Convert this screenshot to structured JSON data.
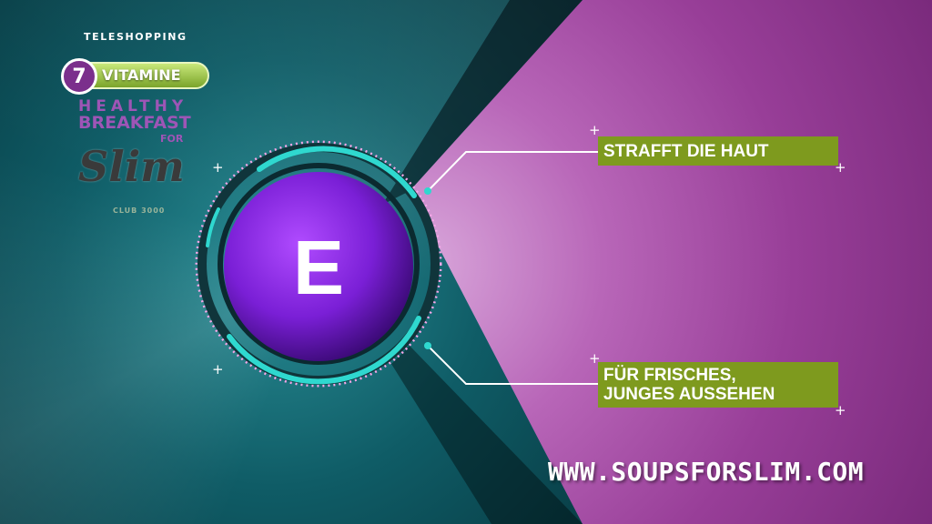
{
  "colors": {
    "teal": "#0f5c66",
    "magenta": "#983e98",
    "accent_green": "#7e9a1e",
    "sphere_purple": "#7a1fd6",
    "ring_cyan": "#2fd8cf"
  },
  "logo": {
    "teleshopping": "TELESHOPPING",
    "vitamin_count": "7",
    "vitamin_label": "VITAMINE",
    "line_healthy": "HEALTHY",
    "line_breakfast": "BREAKFAST",
    "line_for": "FOR",
    "line_slim": "Slim",
    "line_sub": "CLUB 3000"
  },
  "center": {
    "letter": "E"
  },
  "callouts": [
    {
      "lines": [
        "STRAFFT DIE HAUT"
      ]
    },
    {
      "lines": [
        "FÜR FRISCHES,",
        "JUNGES AUSSEHEN"
      ]
    }
  ],
  "website": "WWW.SOUPSFORSLIM.COM",
  "icons": [
    "plus-icon"
  ]
}
